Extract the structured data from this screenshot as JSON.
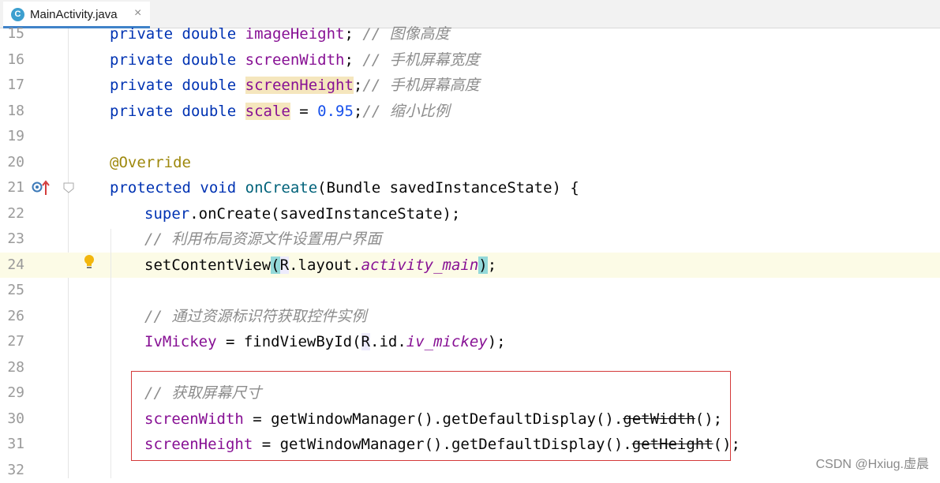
{
  "tab": {
    "icon_letter": "C",
    "file_name": "MainActivity.java",
    "close": "×"
  },
  "editor": {
    "lines": [
      {
        "num": "15",
        "tokens": [
          "private",
          " ",
          "double",
          " ",
          "imageHeight",
          "; ",
          "// 图像高度"
        ]
      },
      {
        "num": "16",
        "tokens": [
          "private",
          " ",
          "double",
          " ",
          "screenWidth",
          "; ",
          "// 手机屏幕宽度"
        ]
      },
      {
        "num": "17",
        "tokens": [
          "private",
          " ",
          "double",
          " ",
          "screenHeight",
          ";",
          "// 手机屏幕高度"
        ]
      },
      {
        "num": "18",
        "tokens": [
          "private",
          " ",
          "double",
          " ",
          "scale",
          " = ",
          "0.95",
          ";",
          "// 缩小比例"
        ]
      },
      {
        "num": "19",
        "tokens": []
      },
      {
        "num": "20",
        "tokens": [
          "@Override"
        ]
      },
      {
        "num": "21",
        "tokens": [
          "protected",
          " ",
          "void",
          " ",
          "onCreate",
          "(Bundle savedInstanceState) {"
        ]
      },
      {
        "num": "22",
        "tokens": [
          "super",
          ".onCreate(savedInstanceState);"
        ]
      },
      {
        "num": "23",
        "tokens": [
          "// 利用布局资源文件设置用户界面"
        ]
      },
      {
        "num": "24",
        "tokens": [
          "setContentView",
          "(",
          "R",
          ".layout.",
          "activity_main",
          ")",
          ";"
        ]
      },
      {
        "num": "25",
        "tokens": []
      },
      {
        "num": "26",
        "tokens": [
          "// 通过资源标识符获取控件实例"
        ]
      },
      {
        "num": "27",
        "tokens": [
          "IvMickey",
          " = findViewById(",
          "R",
          ".id.",
          "iv_mickey",
          ");"
        ]
      },
      {
        "num": "28",
        "tokens": []
      },
      {
        "num": "29",
        "tokens": [
          "// 获取屏幕尺寸"
        ]
      },
      {
        "num": "30",
        "tokens": [
          "screenWidth",
          " = getWindowManager().getDefaultDisplay().",
          "getWidth",
          "();"
        ]
      },
      {
        "num": "31",
        "tokens": [
          "screenHeight",
          " = getWindowManager().getDefaultDisplay().",
          "getHeight",
          "();"
        ]
      },
      {
        "num": "32",
        "tokens": []
      }
    ]
  },
  "gutter_icons": {
    "line21": [
      "override-marker-icon",
      "go-to-super-arrow-icon",
      "fold-icon"
    ],
    "line24": [
      "intention-bulb-icon"
    ]
  },
  "watermark": "CSDN @Hxiug.虚晨"
}
